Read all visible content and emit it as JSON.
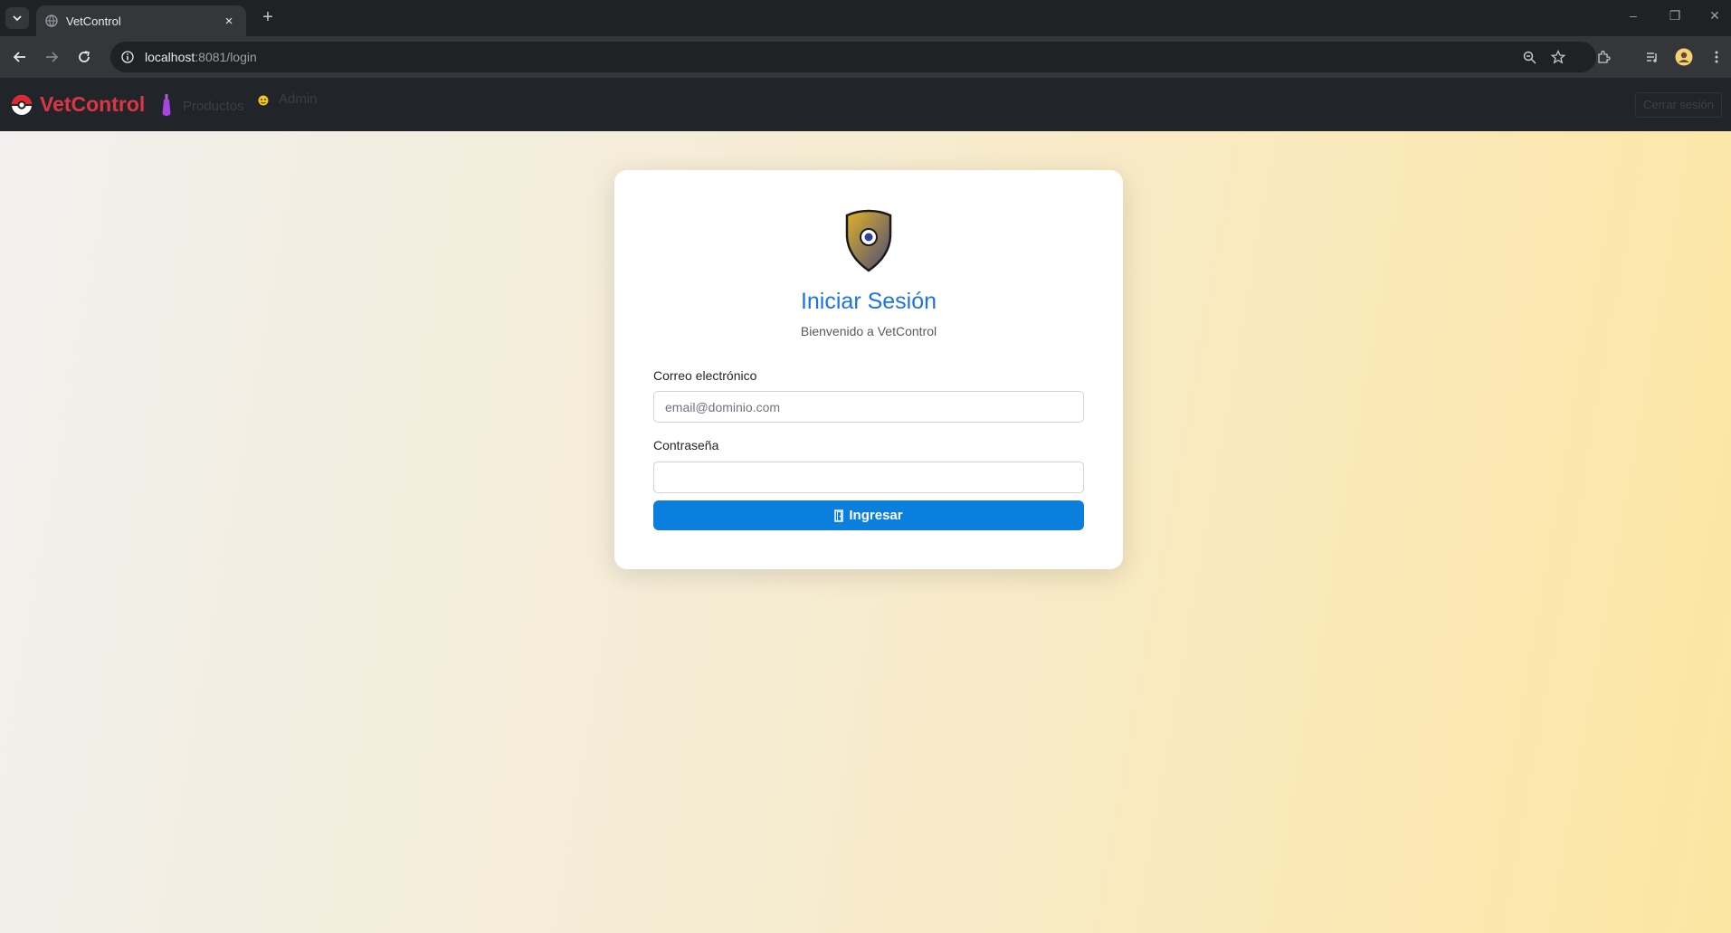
{
  "browser": {
    "tab_title": "VetControl",
    "url_host": "localhost",
    "url_rest": ":8081/login",
    "new_tab": "+",
    "close_tab": "×"
  },
  "navbar": {
    "brand": "VetControl",
    "links": [
      {
        "label": "Productos",
        "icon": "potion-icon"
      },
      {
        "label": "Admin",
        "icon": "admin-icon"
      }
    ],
    "logout": "Cerrar sesión"
  },
  "login": {
    "title": "Iniciar Sesión",
    "subtitle": "Bienvenido a VetControl",
    "email_label": "Correo electrónico",
    "email_placeholder": "email@dominio.com",
    "password_label": "Contraseña",
    "submit_label": "Ingresar",
    "submit_icon": "door-icon"
  },
  "colors": {
    "brand": "#dc3545",
    "accent": "#1a73e8",
    "button": "#0b7fde"
  }
}
